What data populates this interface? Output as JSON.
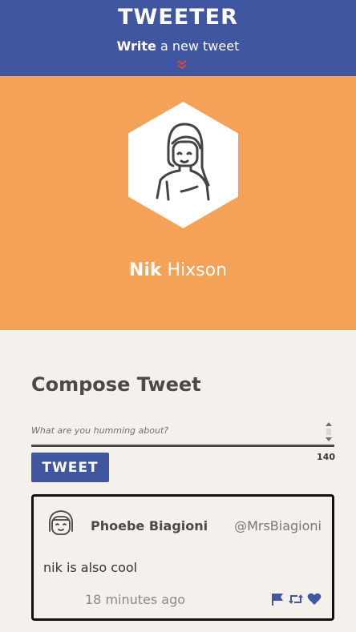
{
  "nav": {
    "brand": "TWEETER",
    "write_bold": "Write",
    "write_rest": " a new tweet",
    "accent_color": "#e8443a"
  },
  "profile": {
    "first_name": "Nik",
    "last_name": " Hixson",
    "background_color": "#f4a257"
  },
  "composer": {
    "title": "Compose Tweet",
    "placeholder": "What are you humming about?",
    "value": "",
    "counter": "140",
    "button_label": "TWEET"
  },
  "tweets": [
    {
      "name": "Phoebe Biagioni",
      "handle": "@MrsBiagioni",
      "text": "nik is also cool",
      "time": "18 minutes ago",
      "actions": [
        "flag-icon",
        "retweet-icon",
        "heart-icon"
      ]
    }
  ],
  "colors": {
    "nav": "#4056a1",
    "button": "#4056a1",
    "page": "#f4f1ec"
  }
}
